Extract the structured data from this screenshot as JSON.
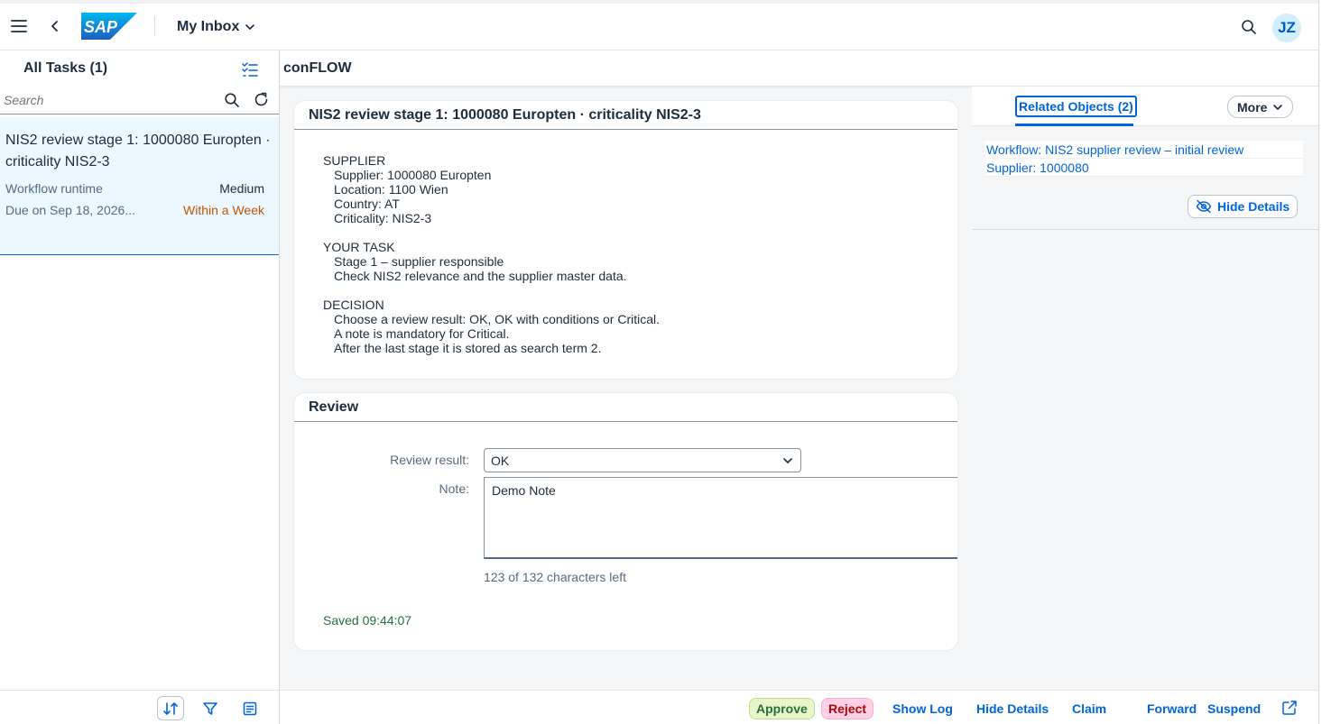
{
  "shell": {
    "app_title": "My Inbox",
    "logo_text": "SAP",
    "avatar_initials": "JZ"
  },
  "master": {
    "header": "All Tasks (1)",
    "search_placeholder": "Search",
    "task": {
      "title": "NIS2 review stage 1: 1000080 Europten · criticality NIS2-3",
      "source": "Workflow runtime",
      "priority": "Medium",
      "due": "Due on Sep 18, 2026...",
      "due_status": "Within a Week"
    }
  },
  "detail": {
    "header": "conFLOW",
    "task_card": {
      "title": "NIS2 review stage 1: 1000080 Europten · criticality NIS2-3",
      "supplier_heading": "SUPPLIER",
      "supplier_lines": [
        "Supplier: 1000080 Europten",
        "Location: 1100 Wien",
        "Country: AT",
        "Criticality: NIS2-3"
      ],
      "task_heading": "YOUR TASK",
      "task_lines": [
        "Stage 1 – supplier responsible",
        "Check NIS2 relevance and the supplier master data."
      ],
      "decision_heading": "DECISION",
      "decision_lines": [
        "Choose a review result: OK, OK with conditions or Critical.",
        "A note is mandatory for Critical.",
        "After the last stage it is stored as search term 2."
      ]
    },
    "review_card": {
      "title": "Review",
      "result_label": "Review result:",
      "result_value": "OK",
      "note_label": "Note:",
      "note_value": "Demo Note",
      "chars_left": "123 of 132 characters left",
      "saved": "Saved 09:44:07"
    },
    "side": {
      "tab_label": "Related Objects (2)",
      "more_label": "More",
      "links": [
        "Workflow: NIS2 supplier review – initial review",
        "Supplier: 1000080"
      ],
      "hide_details": "Hide Details"
    },
    "footer": {
      "approve": "Approve",
      "reject": "Reject",
      "show_log": "Show Log",
      "hide_details": "Hide Details",
      "claim": "Claim",
      "forward": "Forward",
      "suspend": "Suspend"
    }
  },
  "colors": {
    "brand": "#0064d9",
    "selected_bg": "#ebf8ff",
    "warning": "#c35500",
    "positive": "#256f3a",
    "negative": "#aa0808"
  }
}
